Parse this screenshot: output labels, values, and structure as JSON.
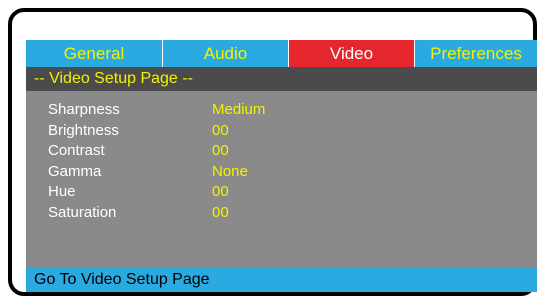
{
  "tabs": [
    {
      "label": "General",
      "active": false
    },
    {
      "label": "Audio",
      "active": false
    },
    {
      "label": "Video",
      "active": true
    },
    {
      "label": "Preferences",
      "active": false
    }
  ],
  "page_title": "-- Video Setup Page --",
  "settings": [
    {
      "label": "Sharpness",
      "value": "Medium"
    },
    {
      "label": "Brightness",
      "value": "00"
    },
    {
      "label": "Contrast",
      "value": "00"
    },
    {
      "label": "Gamma",
      "value": "None"
    },
    {
      "label": "Hue",
      "value": "00"
    },
    {
      "label": "Saturation",
      "value": "00"
    }
  ],
  "status_text": "Go To Video Setup Page",
  "colors": {
    "tab_bg": "#2aaae1",
    "tab_active_bg": "#e6262d",
    "menu_bg": "#8a8a8a",
    "header_bar_bg": "#4b4b4d",
    "value_text": "#f2f200"
  }
}
